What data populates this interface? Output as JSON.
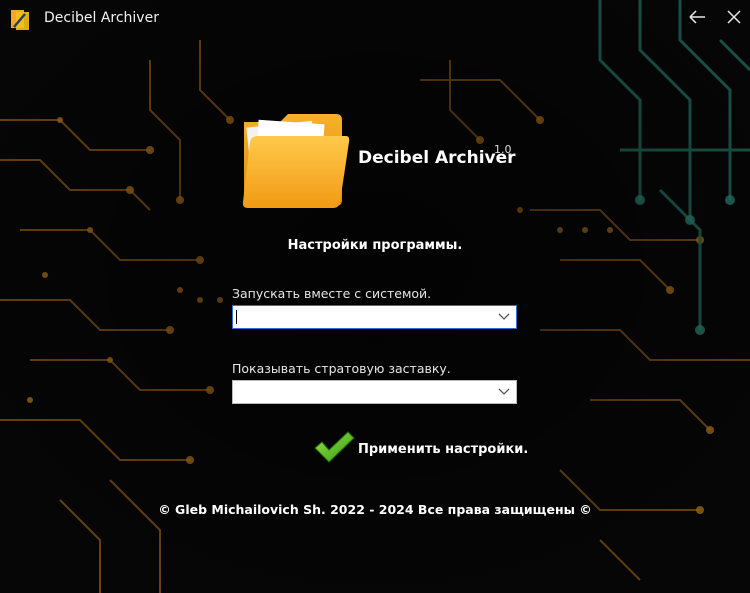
{
  "window": {
    "title": "Decibel Archiver",
    "icon": "app-logo-icon",
    "controls": [
      "back-arrow-icon",
      "close-icon"
    ]
  },
  "header": {
    "app_name": "Decibel Archiver",
    "version": "1.0",
    "logo_icon": "folder-icon"
  },
  "settings": {
    "title": "Настройки программы.",
    "autostart": {
      "label": "Запускать вместе с системой.",
      "value": ""
    },
    "splash": {
      "label": "Показывать стратовую заставку.",
      "value": ""
    },
    "apply_label": "Применить настройки.",
    "apply_icon": "checkmark-icon"
  },
  "footer": {
    "text": "© Gleb Michailovich Sh. 2022 - 2024 Все права защищены ©"
  },
  "colors": {
    "background": "#050505",
    "circuit_orange": "#b8741a",
    "circuit_teal": "#1f5e52",
    "focus_border": "#2f6fd8",
    "check_green": "#5cc81e",
    "folder_orange": "#f7a21b"
  }
}
